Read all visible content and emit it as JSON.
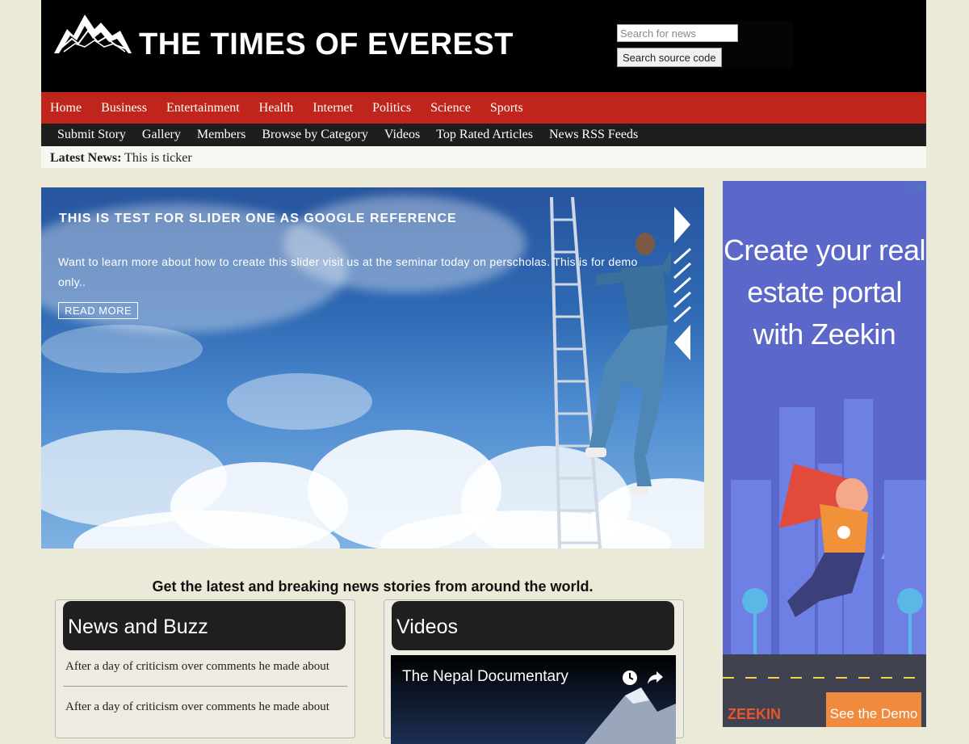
{
  "header": {
    "site_title": "THE TIMES OF EVEREST",
    "search_placeholder": "Search for news",
    "search_button": "Search source code"
  },
  "nav_primary": [
    "Home",
    "Business",
    "Entertainment",
    "Health",
    "Internet",
    "Politics",
    "Science",
    "Sports"
  ],
  "nav_secondary": [
    "Submit Story",
    "Gallery",
    "Members",
    "Browse by Category",
    "Videos",
    "Top Rated Articles",
    "News RSS Feeds"
  ],
  "ticker": {
    "label": "Latest News:",
    "text": "This is ticker"
  },
  "slider": {
    "title": "THIS IS TEST FOR SLIDER ONE AS GOOGLE REFERENCE",
    "text": "Want to learn more about how to create this slider visit us at the seminar today on perscholas. This is for demo only..",
    "button": "READ MORE"
  },
  "ad": {
    "headline": "Create your real estate portal with Zeekin",
    "logo": "ZEEKIN",
    "cta": "See the Demo",
    "close": "▷✕"
  },
  "tagline": "Get the latest and breaking news stories from around the world.",
  "news": {
    "heading": "News and Buzz",
    "items": [
      "After a day of criticism over comments he made about",
      "After a day of criticism over comments he made about"
    ]
  },
  "videos": {
    "heading": "Videos",
    "video_title": "The Nepal Documentary"
  },
  "colors": {
    "header_bg": "#000000",
    "nav_red": "#c0251c",
    "nav_dark": "#1e1e1e",
    "page_bg": "#ebe9d8"
  }
}
